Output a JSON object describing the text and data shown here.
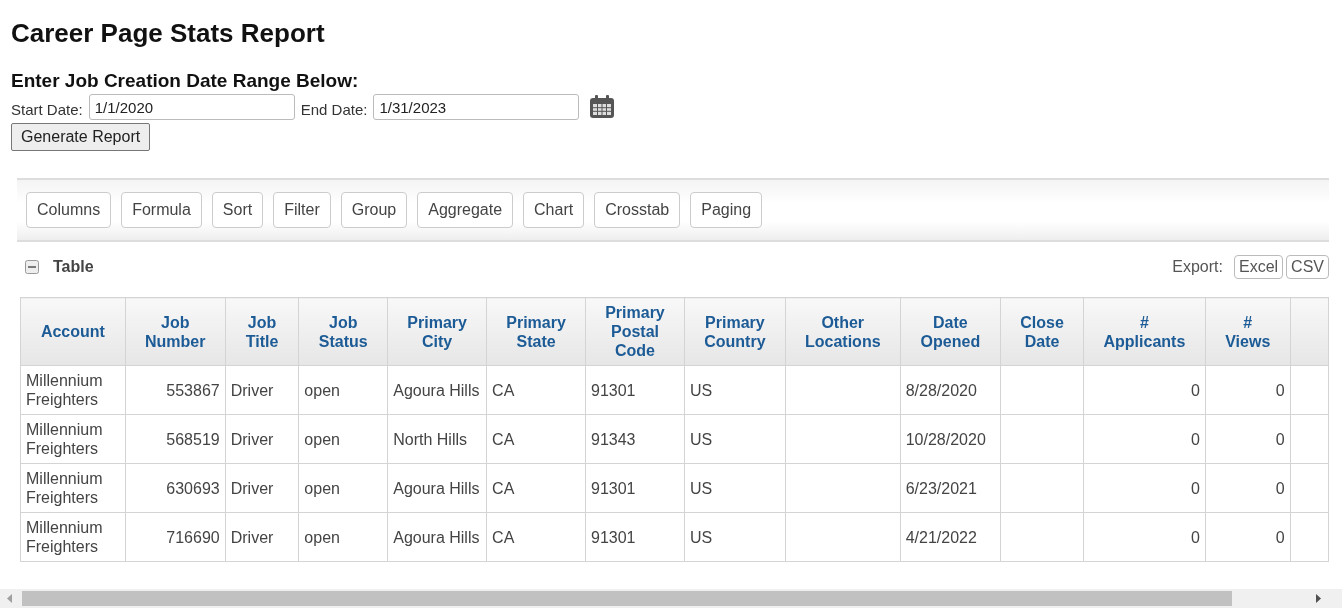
{
  "title": "Career Page Stats Report",
  "date_range": {
    "heading": "Enter Job Creation Date Range Below:",
    "start_label": "Start Date:",
    "start_value": "1/1/2020",
    "end_label": "End Date:",
    "end_value": "1/31/2023",
    "button": "Generate Report"
  },
  "toolbar": [
    "Columns",
    "Formula",
    "Sort",
    "Filter",
    "Group",
    "Aggregate",
    "Chart",
    "Crosstab",
    "Paging"
  ],
  "table_panel": {
    "title": "Table",
    "expanded": true,
    "export_label": "Export:",
    "export_buttons": [
      "Excel",
      "CSV"
    ]
  },
  "table": {
    "columns": [
      {
        "label": "Account",
        "numeric": false
      },
      {
        "label": "Job Number",
        "numeric": true
      },
      {
        "label": "Job Title",
        "numeric": false
      },
      {
        "label": "Job Status",
        "numeric": false
      },
      {
        "label": "Primary City",
        "numeric": false
      },
      {
        "label": "Primary State",
        "numeric": false
      },
      {
        "label": "Primary Postal Code",
        "numeric": false
      },
      {
        "label": "Primary Country",
        "numeric": false
      },
      {
        "label": "Other Locations",
        "numeric": false
      },
      {
        "label": "Date Opened",
        "numeric": false
      },
      {
        "label": "Close Date",
        "numeric": false
      },
      {
        "label": "# Applicants",
        "numeric": true
      },
      {
        "label": "# Views",
        "numeric": true
      }
    ],
    "rows": [
      [
        "Millennium Freighters",
        "553867",
        "Driver",
        "open",
        "Agoura Hills",
        "CA",
        "91301",
        "US",
        "",
        "8/28/2020",
        "",
        "0",
        "0"
      ],
      [
        "Millennium Freighters",
        "568519",
        "Driver",
        "open",
        "North Hills",
        "CA",
        "91343",
        "US",
        "",
        "10/28/2020",
        "",
        "0",
        "0"
      ],
      [
        "Millennium Freighters",
        "630693",
        "Driver",
        "open",
        "Agoura Hills",
        "CA",
        "91301",
        "US",
        "",
        "6/23/2021",
        "",
        "0",
        "0"
      ],
      [
        "Millennium Freighters",
        "716690",
        "Driver",
        "open",
        "Agoura Hills",
        "CA",
        "91301",
        "US",
        "",
        "4/21/2022",
        "",
        "0",
        "0"
      ]
    ]
  }
}
